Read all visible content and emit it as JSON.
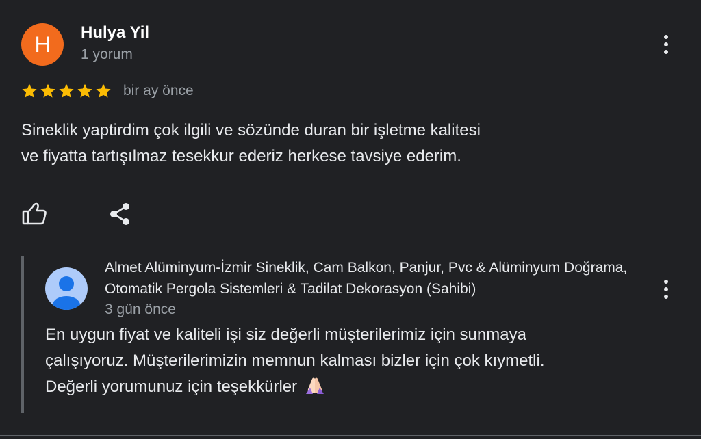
{
  "review": {
    "avatar_initial": "H",
    "author_name": "Hulya Yil",
    "author_meta": "1 yorum",
    "rating": 5,
    "star_color": "#fbbc04",
    "date": "bir ay önce",
    "text_line1": "Sineklik yaptirdim çok ilgili ve sözünde duran bir işletme kalitesi",
    "text_line2": "ve fiyatta tartışılmaz tesekkur ederiz herkese tavsiye ederim.",
    "actions": {
      "like_icon": "thumb-up-icon",
      "share_icon": "share-icon"
    }
  },
  "owner_reply": {
    "owner_name": "Almet Alüminyum-İzmir Sineklik, Cam Balkon, Panjur, Pvc & Alüminyum Doğrama, Otomatik Pergola Sistemleri & Tadilat Dekorasyon (Sahibi)",
    "date": "3 gün önce",
    "text_line1": "En uygun fiyat ve kaliteli işi siz değerli müşterilerimiz için sunmaya",
    "text_line2": "çalışıyoruz. Müşterilerimizin memnun kalması bizler için çok kıymetli.",
    "text_line3": "Değerli yorumunuz için teşekkürler",
    "emoji": "folded-hands-emoji"
  },
  "colors": {
    "background": "#202124",
    "avatar_orange": "#f26b1d",
    "owner_avatar_blue": "#aecbfa",
    "secondary_text": "#9aa0a6"
  }
}
